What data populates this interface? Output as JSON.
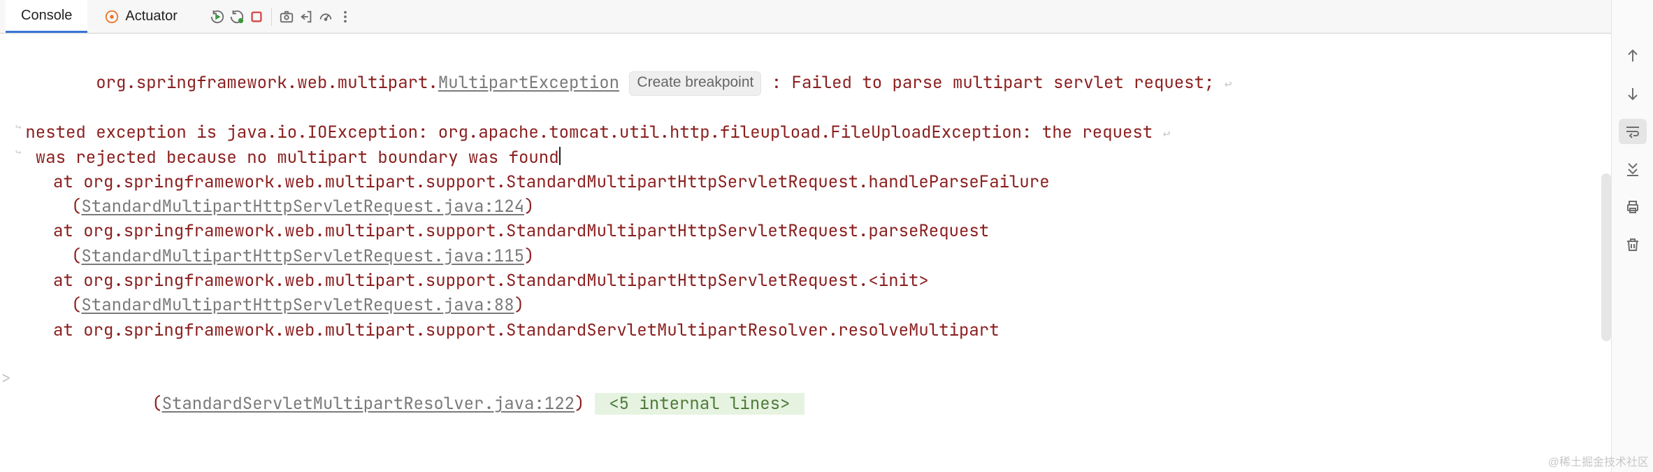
{
  "tabs": {
    "console": "Console",
    "actuator": "Actuator"
  },
  "toolbar_icons": {
    "rerun": "rerun-icon",
    "rerun_mod": "rerun-modified-icon",
    "stop": "stop-icon",
    "camera": "screenshot-icon",
    "exit": "exit-icon",
    "gauge": "gauge-icon",
    "more": "more-icon"
  },
  "exception": {
    "prefix": "org.springframework.web.multipart.",
    "klass": "MultipartException",
    "breakpoint_label": "Create breakpoint",
    "message_part1": " : Failed to parse multipart servlet request;",
    "message_line2a": "nested exception is java.io.IOException: org.apache.tomcat.util.http.fileupload.FileUploadException: the request",
    "message_line3a": " was rejected because no multipart boundary was found"
  },
  "stack": [
    {
      "at": "at org.springframework.web.multipart.support.StandardMultipartHttpServletRequest.handleParseFailure",
      "loc_open": "(",
      "loc_link": "StandardMultipartHttpServletRequest.java:124",
      "loc_close": ")"
    },
    {
      "at": "at org.springframework.web.multipart.support.StandardMultipartHttpServletRequest.parseRequest",
      "loc_open": "(",
      "loc_link": "StandardMultipartHttpServletRequest.java:115",
      "loc_close": ")"
    },
    {
      "at": "at org.springframework.web.multipart.support.StandardMultipartHttpServletRequest.<init>",
      "loc_open": "(",
      "loc_link": "StandardMultipartHttpServletRequest.java:88",
      "loc_close": ")"
    },
    {
      "at": "at org.springframework.web.multipart.support.StandardServletMultipartResolver.resolveMultipart",
      "loc_open": "(",
      "loc_link": "StandardServletMultipartResolver.java:122",
      "loc_close": ")",
      "hidden": " <5 internal lines> "
    }
  ],
  "side": {
    "up": "arrow-up-icon",
    "down": "arrow-down-icon",
    "softwrap": "soft-wrap-icon",
    "scroll_end": "scroll-to-end-icon",
    "print": "print-icon",
    "trash": "trash-icon"
  },
  "watermark": "@稀土掘金技术社区"
}
